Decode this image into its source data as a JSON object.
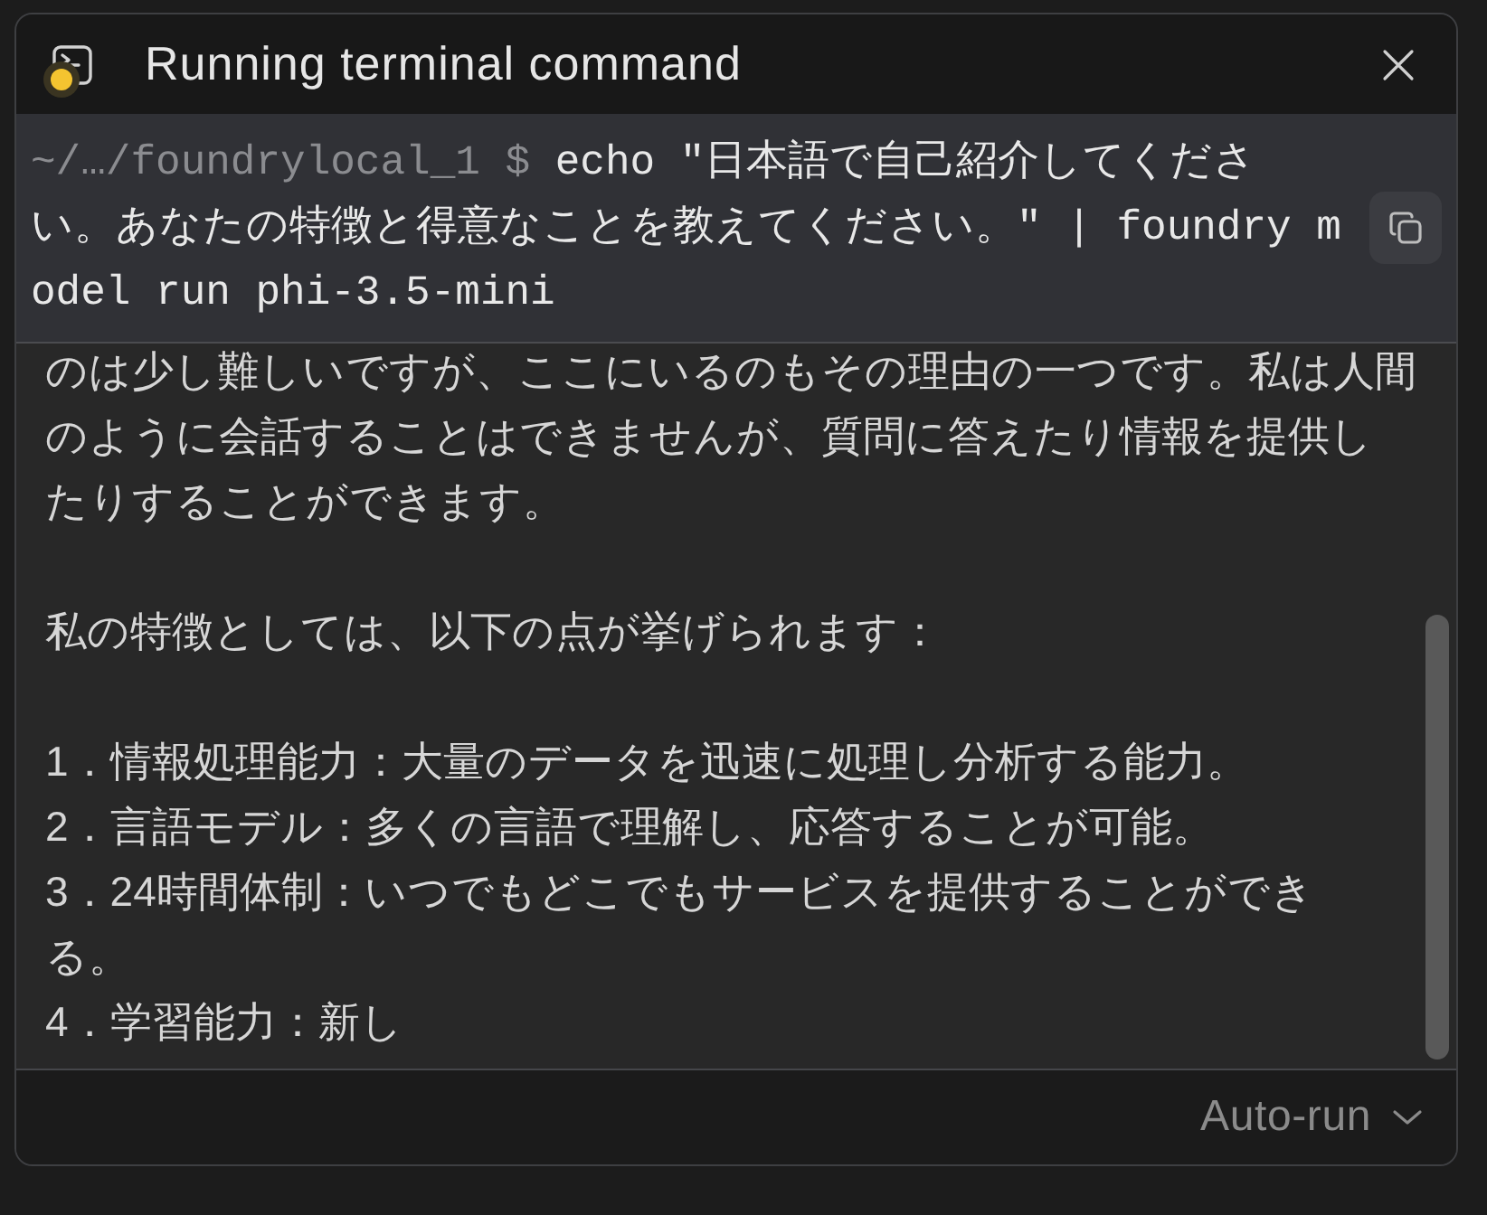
{
  "header": {
    "title": "Running terminal command",
    "running": true
  },
  "command": {
    "prompt": "~/…/foundrylocal_1 $",
    "lines": [
      "echo \"日本語で自己紹介してくださ",
      "い。あなたの特徴と得意なことを教えてください。\" | foundry m",
      "odel run phi-3.5-mini"
    ]
  },
  "output": {
    "blocks": [
      {
        "lines": [
          "のは少し難しいですが、ここにいるのもその理由の一つです。私は人間",
          "のように会話することはできませんが、質問に答えたり情報を提供し",
          "たりすることができます。"
        ]
      },
      {
        "lines": [
          "私の特徴としては、以下の点が挙げられます："
        ]
      },
      {
        "lines": [
          "1．情報処理能力：大量のデータを迅速に処理し分析する能力。",
          "2．言語モデル：多くの言語で理解し、応答することが可能。",
          "3．24時間体制：いつでもどこでもサービスを提供することができ",
          "る。",
          "4．学習能力：新し"
        ]
      }
    ]
  },
  "footer": {
    "mode": "Auto-run"
  }
}
